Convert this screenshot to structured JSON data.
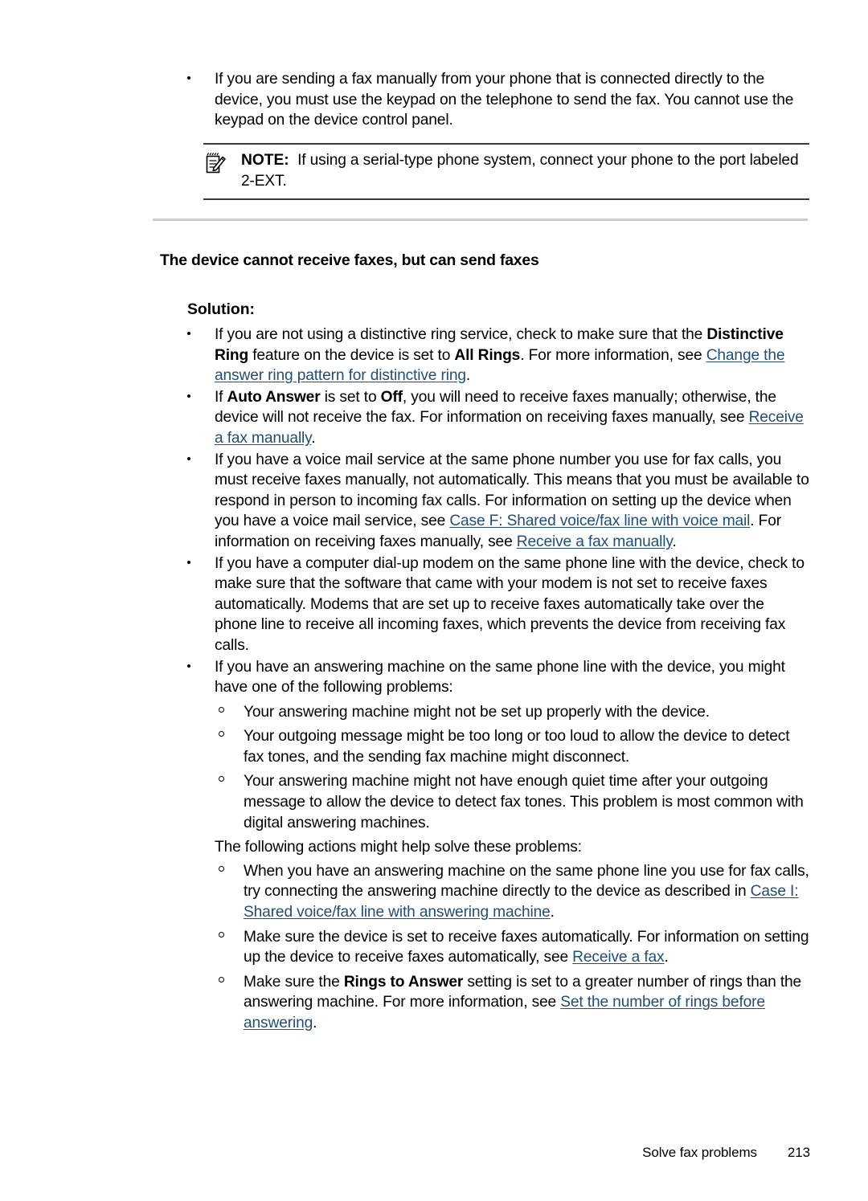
{
  "page": {
    "footer_title": "Solve fax problems",
    "footer_page_number": "213",
    "link_color": "#1F4E79",
    "rule_color": "#3a3a3a",
    "divider_color": "#c9cbcd"
  },
  "intro_bullet": {
    "text": "If you are sending a fax manually from your phone that is connected directly to the device, you must use the keypad on the telephone to send the fax. You cannot use the keypad on the device control panel."
  },
  "note": {
    "icon": "note-pencil-icon",
    "label": "NOTE:",
    "text": "If using a serial-type phone system, connect your phone to the port labeled 2-EXT."
  },
  "section": {
    "heading": "The device cannot receive faxes, but can send faxes",
    "solution_label": "Solution:"
  },
  "bullets": {
    "b1": {
      "p1": "If you are not using a distinctive ring service, check to make sure that the ",
      "bold1": "Distinctive Ring",
      "p2": " feature on the device is set to ",
      "bold2": "All Rings",
      "p3": ". For more information, see ",
      "link1": "Change the answer ring pattern for distinctive ring",
      "p4": "."
    },
    "b2": {
      "p1": "If ",
      "bold1": "Auto Answer",
      "p2": " is set to ",
      "bold2": "Off",
      "p3": ", you will need to receive faxes manually; otherwise, the device will not receive the fax. For information on receiving faxes manually, see ",
      "link1": "Receive a fax manually",
      "p4": "."
    },
    "b3": {
      "p1": "If you have a voice mail service at the same phone number you use for fax calls, you must receive faxes manually, not automatically. This means that you must be available to respond in person to incoming fax calls. For information on setting up the device when you have a voice mail service, see ",
      "link1": "Case F: Shared voice/fax line with voice mail",
      "p2": ". For information on receiving faxes manually, see ",
      "link2": "Receive a fax manually",
      "p3": "."
    },
    "b4": {
      "text": "If you have a computer dial-up modem on the same phone line with the device, check to make sure that the software that came with your modem is not set to receive faxes automatically. Modems that are set up to receive faxes automatically take over the phone line to receive all incoming faxes, which prevents the device from receiving fax calls."
    },
    "b5": {
      "text": "If you have an answering machine on the same phone line with the device, you might have one of the following problems:"
    }
  },
  "problems": [
    {
      "text": "Your answering machine might not be set up properly with the device."
    },
    {
      "text": "Your outgoing message might be too long or too loud to allow the device to detect fax tones, and the sending fax machine might disconnect."
    },
    {
      "text": "Your answering machine might not have enough quiet time after your outgoing message to allow the device to detect fax tones. This problem is most common with digital answering machines."
    }
  ],
  "actions_intro": "The following actions might help solve these problems:",
  "actions": {
    "a1": {
      "p1": "When you have an answering machine on the same phone line you use for fax calls, try connecting the answering machine directly to the device as described in ",
      "link1": "Case I: Shared voice/fax line with answering machine",
      "p2": "."
    },
    "a2": {
      "p1": "Make sure the device is set to receive faxes automatically. For information on setting up the device to receive faxes automatically, see ",
      "link1": "Receive a fax",
      "p2": "."
    },
    "a3": {
      "p1": "Make sure the ",
      "bold1": "Rings to Answer",
      "p2": " setting is set to a greater number of rings than the answering machine. For more information, see ",
      "link1": "Set the number of rings before answering",
      "p3": "."
    }
  }
}
